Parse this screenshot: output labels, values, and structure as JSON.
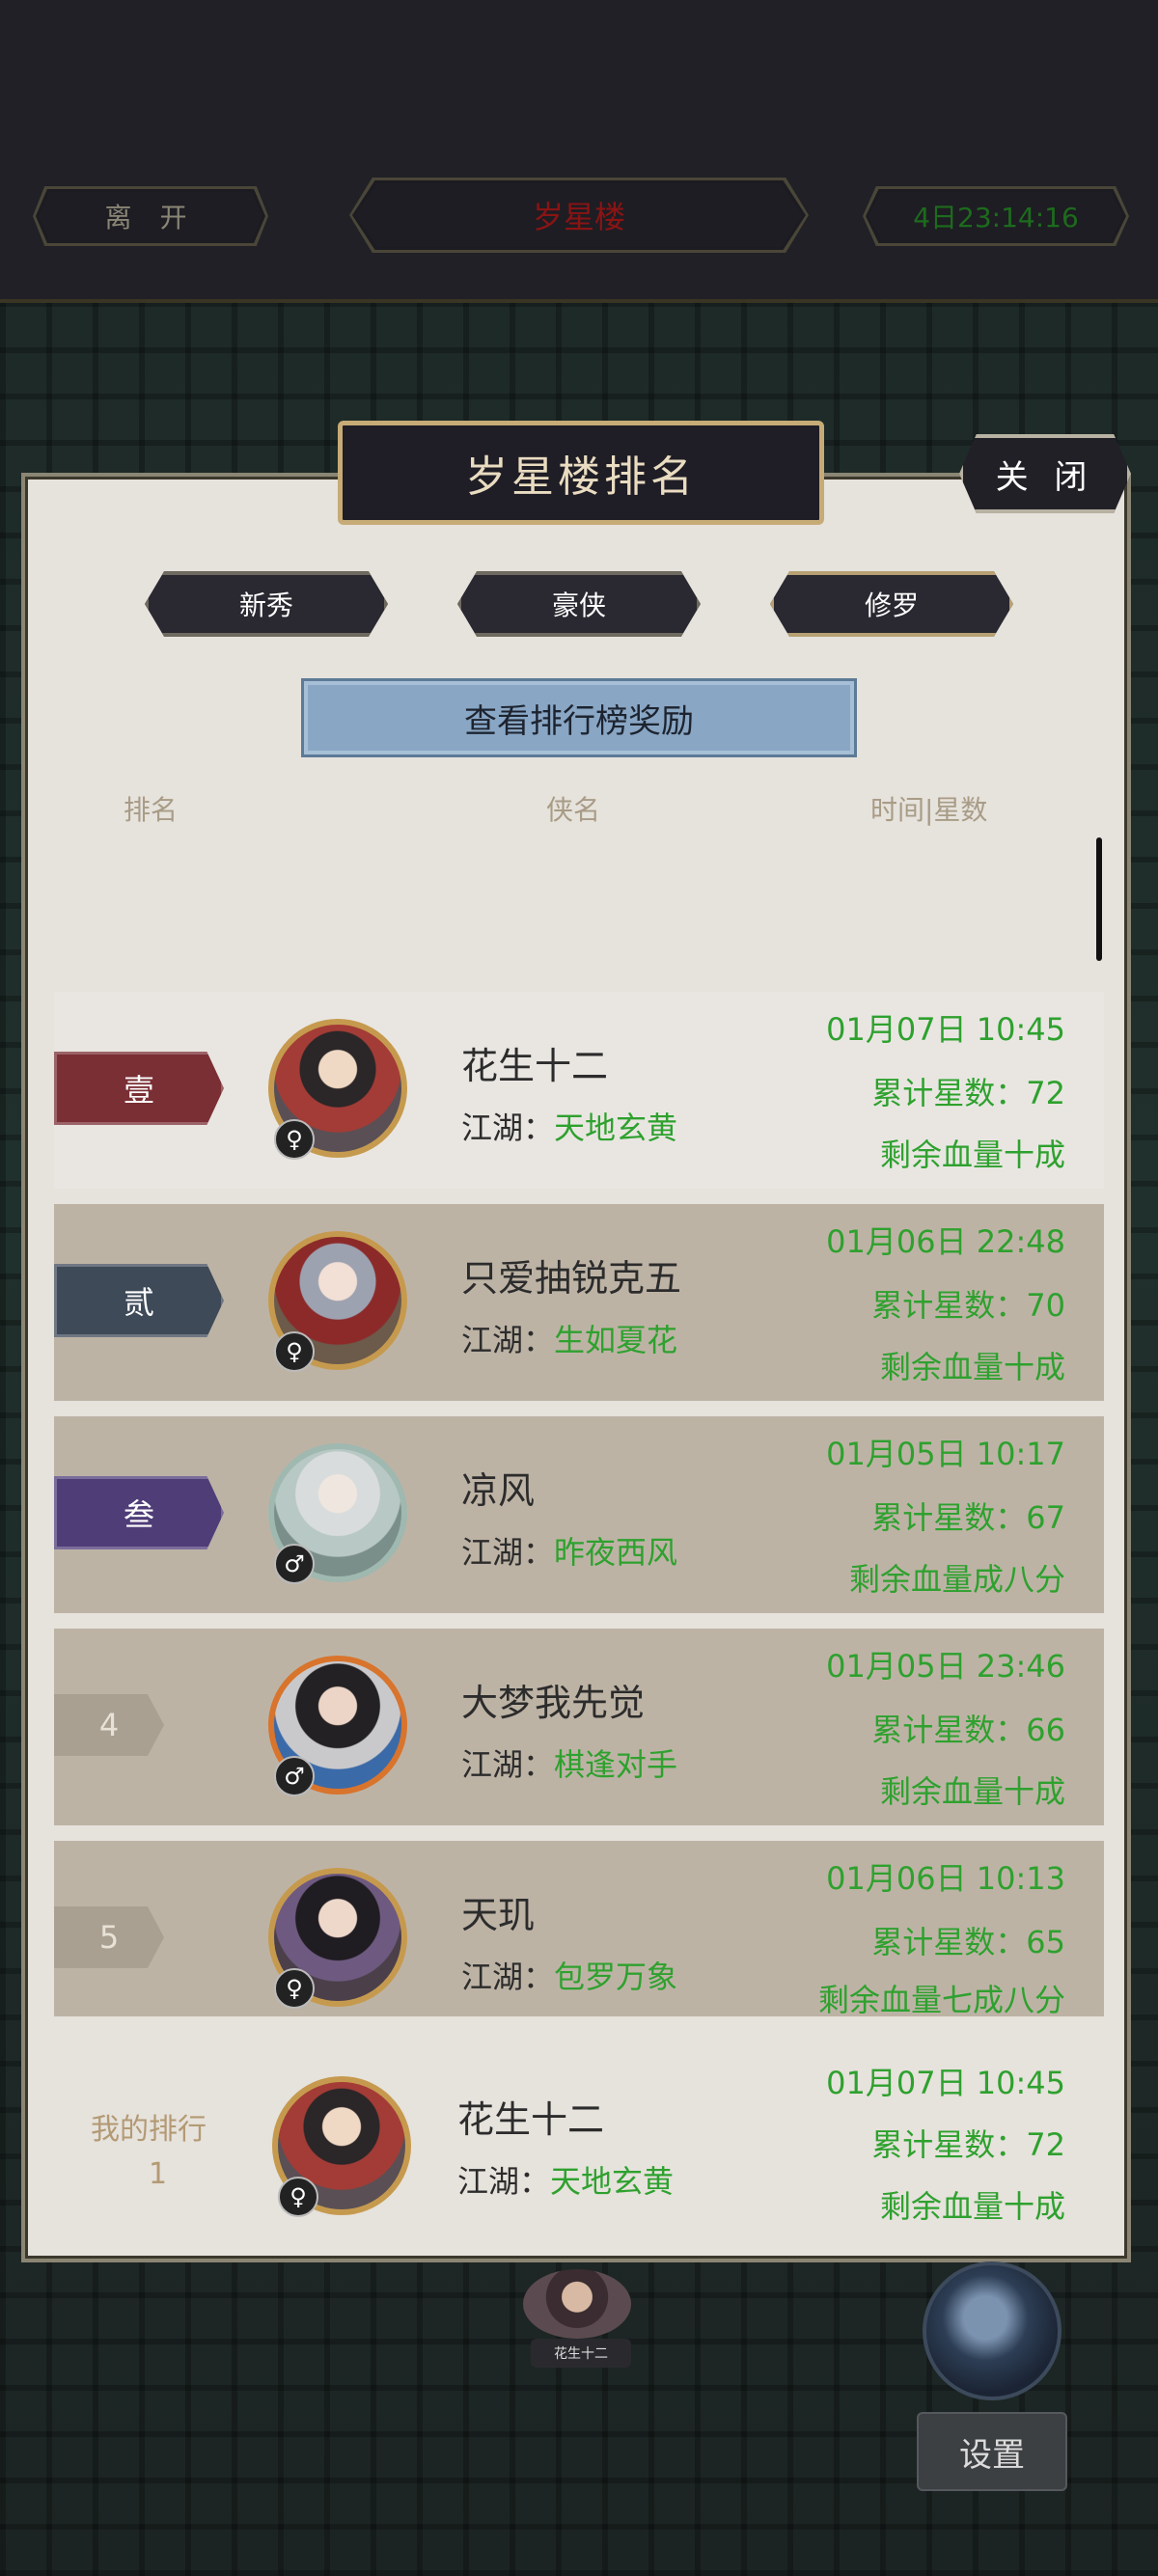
{
  "top_bar": {
    "leave_label": "离 开",
    "location_title": "岁星楼",
    "countdown": "4日23:14:16"
  },
  "panel": {
    "title": "岁星楼排名",
    "close_label": "关 闭",
    "tabs": [
      {
        "label": "新秀",
        "selected": false
      },
      {
        "label": "豪侠",
        "selected": false
      },
      {
        "label": "修罗",
        "selected": true
      }
    ],
    "reward_button": "查看排行榜奖励",
    "columns": {
      "rank": "排名",
      "name": "侠名",
      "time_stars": "时间|星数"
    }
  },
  "colors": {
    "accent_green": "#2ea12e",
    "rank1_badge": "#7a2f34",
    "rank2_badge": "#3f4a58",
    "rank3_badge": "#4f3d78"
  },
  "rows": [
    {
      "rank": "壹",
      "rank_color": "#7a2f34",
      "gender": "♀",
      "name": "花生十二",
      "guild_label": "江湖：",
      "guild": "天地玄黄",
      "time": "01月07日 10:45",
      "stars": "累计星数：72",
      "hp": "剩余血量十成"
    },
    {
      "rank": "贰",
      "rank_color": "#3f4a58",
      "gender": "♀",
      "name": "只爱抽锐克五",
      "guild_label": "江湖：",
      "guild": "生如夏花",
      "time": "01月06日 22:48",
      "stars": "累计星数：70",
      "hp": "剩余血量十成"
    },
    {
      "rank": "叁",
      "rank_color": "#4f3d78",
      "gender": "♂",
      "name": "凉风",
      "guild_label": "江湖：",
      "guild": "昨夜西风",
      "time": "01月05日 10:17",
      "stars": "累计星数：67",
      "hp": "剩余血量成八分"
    },
    {
      "rank": "4",
      "gender": "♂",
      "name": "大梦我先觉",
      "guild_label": "江湖：",
      "guild": "棋逢对手",
      "time": "01月05日 23:46",
      "stars": "累计星数：66",
      "hp": "剩余血量十成"
    },
    {
      "rank": "5",
      "gender": "♀",
      "name": "天玑",
      "guild_label": "江湖：",
      "guild": "包罗万象",
      "time": "01月06日 10:13",
      "stars": "累计星数：65",
      "hp": "剩余血量七成八分"
    }
  ],
  "my_rank": {
    "label": "我的排行",
    "value": "1",
    "gender": "♀",
    "name": "花生十二",
    "guild_label": "江湖：",
    "guild": "天地玄黄",
    "time": "01月07日 10:45",
    "stars": "累计星数：72",
    "hp": "剩余血量十成"
  },
  "bottom": {
    "player_name_tag": "花生十二",
    "settings_label": "设置"
  }
}
